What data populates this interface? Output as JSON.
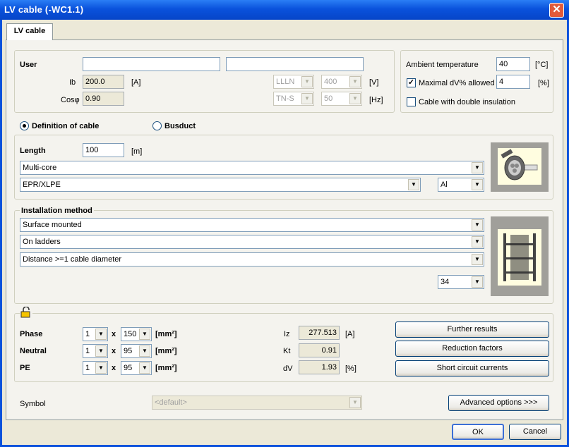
{
  "window": {
    "title": "LV cable (-WC1.1)",
    "close_symbol": "✕"
  },
  "tab": {
    "label": "LV cable"
  },
  "user": {
    "label": "User",
    "field1": "",
    "field2": ""
  },
  "ib": {
    "label": "Ib",
    "value": "200.0",
    "unit": "[A]"
  },
  "cos": {
    "label": "Cosφ",
    "value": "0.90"
  },
  "system": {
    "lines": "LLLN",
    "voltage": "400",
    "voltage_unit": "[V]",
    "earthing": "TN-S",
    "frequency": "50",
    "frequency_unit": "[Hz]"
  },
  "ambient": {
    "label": "Ambient temperature",
    "value": "40",
    "unit": "[°C]"
  },
  "maxdv": {
    "label": "Maximal dV% allowed",
    "checked": true,
    "value": "4",
    "unit": "[%]"
  },
  "double_insulation": {
    "label": "Cable with double insulation",
    "checked": false
  },
  "type_choice": {
    "definition_label": "Definition of cable",
    "busduct_label": "Busduct",
    "selected": "definition"
  },
  "cable": {
    "length_label": "Length",
    "length_value": "100",
    "length_unit": "[m]",
    "core": "Multi-core",
    "insulation": "EPR/XLPE",
    "material": "Al"
  },
  "installation": {
    "label": "Installation method",
    "method": "Surface mounted",
    "support": "On ladders",
    "spacing": "Distance >=1 cable diameter",
    "reference": "34"
  },
  "sizing": {
    "phase": {
      "label": "Phase",
      "count": "1",
      "x": "x",
      "size": "150",
      "unit": "[mm²]"
    },
    "neutral": {
      "label": "Neutral",
      "count": "1",
      "x": "x",
      "size": "95",
      "unit": "[mm²]"
    },
    "pe": {
      "label": "PE",
      "count": "1",
      "x": "x",
      "size": "95",
      "unit": "[mm²]"
    }
  },
  "results": {
    "iz": {
      "label": "Iz",
      "value": "277.513",
      "unit": "[A]"
    },
    "kt": {
      "label": "Kt",
      "value": "0.91"
    },
    "dv": {
      "label": "dV",
      "value": "1.93",
      "unit": "[%]"
    }
  },
  "buttons": {
    "further": "Further results",
    "reduction": "Reduction factors",
    "short_circuit": "Short circuit currents",
    "advanced": "Advanced options >>>",
    "ok": "OK",
    "cancel": "Cancel"
  },
  "symbol": {
    "label": "Symbol",
    "value": "<default>"
  },
  "colors": {
    "titlebar": "#0a52dc",
    "dialog": "#ece9d8",
    "panel": "#f4f3ee"
  }
}
